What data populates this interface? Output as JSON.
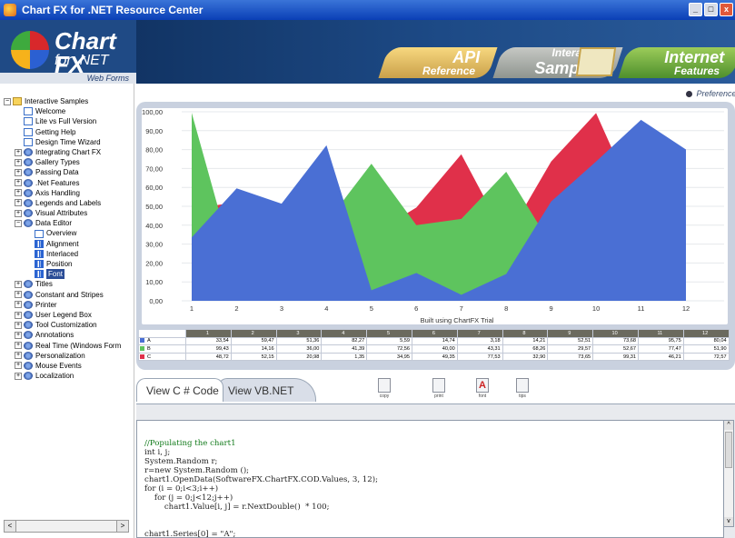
{
  "window": {
    "title": "Chart FX for .NET Resource Center"
  },
  "header": {
    "logo_title": "Chart FX",
    "logo_subtitle": "for .NET",
    "webforms": "Web Forms",
    "tabs": [
      {
        "big": "API",
        "small": "Reference"
      },
      {
        "big": "Samples",
        "small": "Interactive"
      },
      {
        "big": "Internet",
        "small": "Features"
      }
    ]
  },
  "preferences": "Preferences",
  "sidebar": {
    "tree": [
      {
        "label": "Interactive Samples",
        "icon": "folder-icon",
        "exp": "minus",
        "level": 0
      },
      {
        "label": "Welcome",
        "icon": "doc-icon",
        "level": 1
      },
      {
        "label": "Lite vs Full Version",
        "icon": "doc-icon",
        "level": 1
      },
      {
        "label": "Getting Help",
        "icon": "doc-icon",
        "level": 1
      },
      {
        "label": "Design Time Wizard",
        "icon": "doc-icon",
        "level": 1
      },
      {
        "label": "Integrating Chart FX",
        "icon": "gear-icon",
        "exp": "plus",
        "level": 1
      },
      {
        "label": "Gallery Types",
        "icon": "gear-icon",
        "exp": "plus",
        "level": 1
      },
      {
        "label": "Passing Data",
        "icon": "gear-icon",
        "exp": "plus",
        "level": 1
      },
      {
        "label": ".Net Features",
        "icon": "gear-icon",
        "exp": "plus",
        "level": 1
      },
      {
        "label": "Axis Handling",
        "icon": "gear-icon",
        "exp": "plus",
        "level": 1
      },
      {
        "label": "Legends and Labels",
        "icon": "gear-icon",
        "exp": "plus",
        "level": 1
      },
      {
        "label": "Visual Attributes",
        "icon": "gear-icon",
        "exp": "plus",
        "level": 1
      },
      {
        "label": "Data Editor",
        "icon": "gear-icon",
        "exp": "minus",
        "level": 1
      },
      {
        "label": "Overview",
        "icon": "doc-icon",
        "level": 2
      },
      {
        "label": "Alignment",
        "icon": "chart-icon",
        "level": 2
      },
      {
        "label": "Interlaced",
        "icon": "chart-icon",
        "level": 2
      },
      {
        "label": "Position",
        "icon": "chart-icon",
        "level": 2
      },
      {
        "label": "Font",
        "icon": "chart-icon",
        "level": 2,
        "selected": true
      },
      {
        "label": "Titles",
        "icon": "gear-icon",
        "exp": "plus",
        "level": 1
      },
      {
        "label": "Constant and Stripes",
        "icon": "gear-icon",
        "exp": "plus",
        "level": 1
      },
      {
        "label": "Printer",
        "icon": "gear-icon",
        "exp": "plus",
        "level": 1
      },
      {
        "label": "User Legend Box",
        "icon": "gear-icon",
        "exp": "plus",
        "level": 1
      },
      {
        "label": "Tool Customization",
        "icon": "gear-icon",
        "exp": "plus",
        "level": 1
      },
      {
        "label": "Annotations",
        "icon": "gear-icon",
        "exp": "plus",
        "level": 1
      },
      {
        "label": "Real Time (Windows Form",
        "icon": "gear-icon",
        "exp": "plus",
        "level": 1
      },
      {
        "label": "Personalization",
        "icon": "gear-icon",
        "exp": "plus",
        "level": 1
      },
      {
        "label": "Mouse Events",
        "icon": "gear-icon",
        "exp": "plus",
        "level": 1
      },
      {
        "label": "Localization",
        "icon": "gear-icon",
        "exp": "plus",
        "level": 1
      }
    ]
  },
  "chart_data": {
    "type": "area",
    "xlabel": "Built using ChartFX Trial",
    "ylabel": "",
    "ylim": [
      0,
      100
    ],
    "ytick_labels": [
      "0,00",
      "10,00",
      "20,00",
      "30,00",
      "40,00",
      "50,00",
      "60,00",
      "70,00",
      "80,00",
      "90,00",
      "100,00"
    ],
    "categories": [
      "1",
      "2",
      "3",
      "4",
      "5",
      "6",
      "7",
      "8",
      "9",
      "10",
      "11",
      "12"
    ],
    "series": [
      {
        "name": "A",
        "color": "#4a6fd4",
        "values": [
          33.54,
          59.47,
          51.36,
          82.27,
          5.59,
          14.74,
          3.18,
          14.21,
          52.51,
          73.68,
          95.75,
          80.04
        ],
        "labels": [
          "33,54",
          "59,47",
          "51,36",
          "82,27",
          "5,59",
          "14,74",
          "3,18",
          "14,21",
          "52,51",
          "73,68",
          "95,75",
          "80,04"
        ]
      },
      {
        "name": "B",
        "color": "#5ec45e",
        "values": [
          99.43,
          14.16,
          36.0,
          41.39,
          72.56,
          40.0,
          43.31,
          68.26,
          29.57,
          52.67,
          77.47,
          51.9
        ],
        "labels": [
          "99,43",
          "14,16",
          "36,00",
          "41,39",
          "72,56",
          "40,00",
          "43,31",
          "68,26",
          "29,57",
          "52,67",
          "77,47",
          "51,90"
        ]
      },
      {
        "name": "C",
        "color": "#e0304a",
        "values": [
          48.72,
          52.15,
          20.98,
          1.35,
          34.95,
          49.35,
          77.53,
          32.9,
          73.65,
          99.31,
          46.21,
          72.57
        ],
        "labels": [
          "48,72",
          "52,15",
          "20,98",
          "1,35",
          "34,95",
          "49,35",
          "77,53",
          "32,90",
          "73,65",
          "99,31",
          "46,21",
          "72,57"
        ]
      }
    ],
    "grid": true,
    "legend": "data-table-below"
  },
  "code_tabs": {
    "c": "View C # Code",
    "vb": "View VB.NET Code"
  },
  "toolbar": {
    "copy": "copy",
    "print": "print",
    "font": "font",
    "tips": "tips"
  },
  "code": {
    "comment": "//Populating the chart1",
    "lines": "int i, j;\nSystem.Random r;\nr=new System.Random ();\nchart1.OpenData(SoftwareFX.ChartFX.COD.Values, 3, 12);\nfor (i = 0;i<3;i++)\n    for (j = 0;j<12;j++)\n        chart1.Value[i, j] = r.NextDouble()  * 100;\n\n\nchart1.Series[0] = \"A\";"
  }
}
